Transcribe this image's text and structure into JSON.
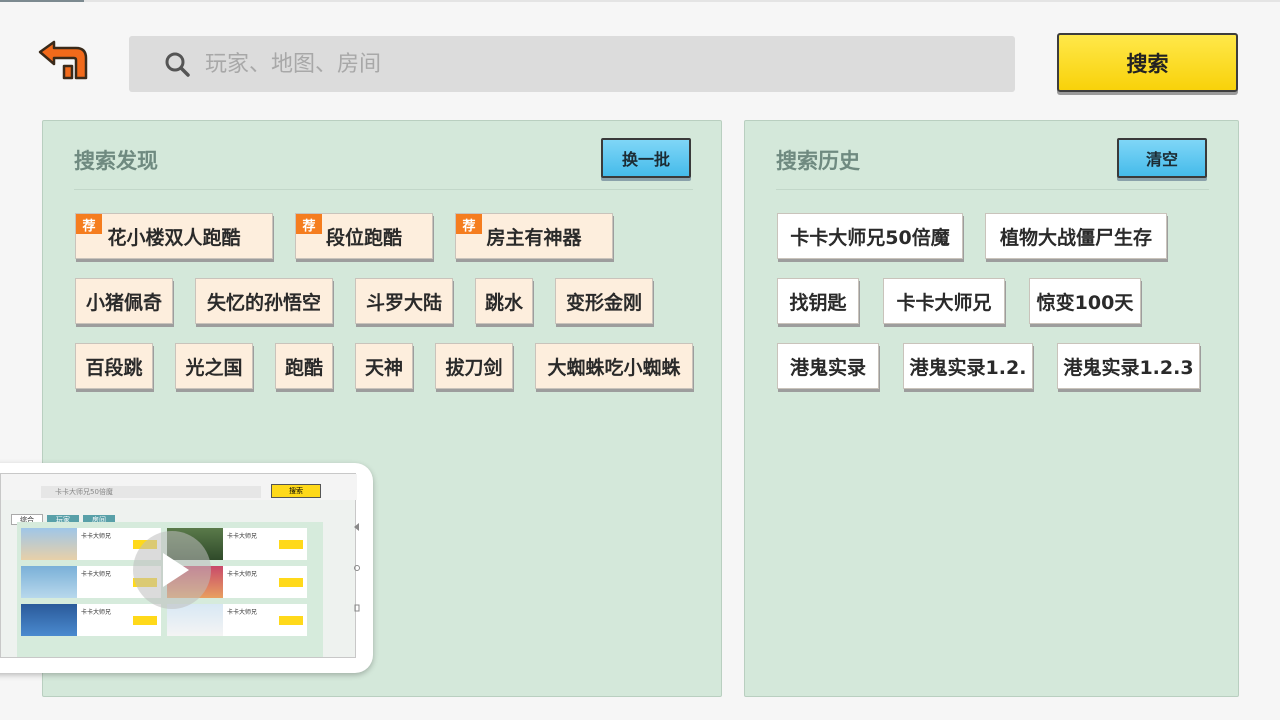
{
  "search": {
    "placeholder": "玩家、地图、房间",
    "button_label": "搜索"
  },
  "discover": {
    "title": "搜索发现",
    "refresh_label": "换一批",
    "recommend_badge": "荐",
    "tags": [
      {
        "label": "花小楼双人跑酷",
        "recommended": true
      },
      {
        "label": "段位跑酷",
        "recommended": true
      },
      {
        "label": "房主有神器",
        "recommended": true
      },
      {
        "label": "小猪佩奇",
        "recommended": false
      },
      {
        "label": "失忆的孙悟空",
        "recommended": false
      },
      {
        "label": "斗罗大陆",
        "recommended": false
      },
      {
        "label": "跳水",
        "recommended": false
      },
      {
        "label": "变形金刚",
        "recommended": false
      },
      {
        "label": "百段跳",
        "recommended": false
      },
      {
        "label": "光之国",
        "recommended": false
      },
      {
        "label": "跑酷",
        "recommended": false
      },
      {
        "label": "天神",
        "recommended": false
      },
      {
        "label": "拔刀剑",
        "recommended": false
      },
      {
        "label": "大蜘蛛吃小蜘蛛",
        "recommended": false
      }
    ]
  },
  "history": {
    "title": "搜索历史",
    "clear_label": "清空",
    "tags": [
      "卡卡大师兄50倍魔",
      "植物大战僵尸生存",
      "找钥匙",
      "卡卡大师兄",
      "惊变100天",
      "港鬼实录",
      "港鬼实录1.2.",
      "港鬼实录1.2.3"
    ]
  },
  "video_preview": {
    "search_text": "卡卡大师兄50倍魔",
    "button_label": "搜索",
    "tabs": [
      "综合",
      "玩家",
      "房间"
    ],
    "row_title": "卡卡大师兄"
  },
  "colors": {
    "panel_bg": "#d4e8da",
    "tag_bg": "#fdeedd",
    "accent_yellow": "#f8d20a",
    "accent_blue": "#45bbea",
    "badge_orange": "#f57d1f",
    "back_orange": "#f26a1b"
  },
  "icons": {
    "back": "back-arrow-icon",
    "search": "search-icon",
    "play": "play-icon"
  }
}
